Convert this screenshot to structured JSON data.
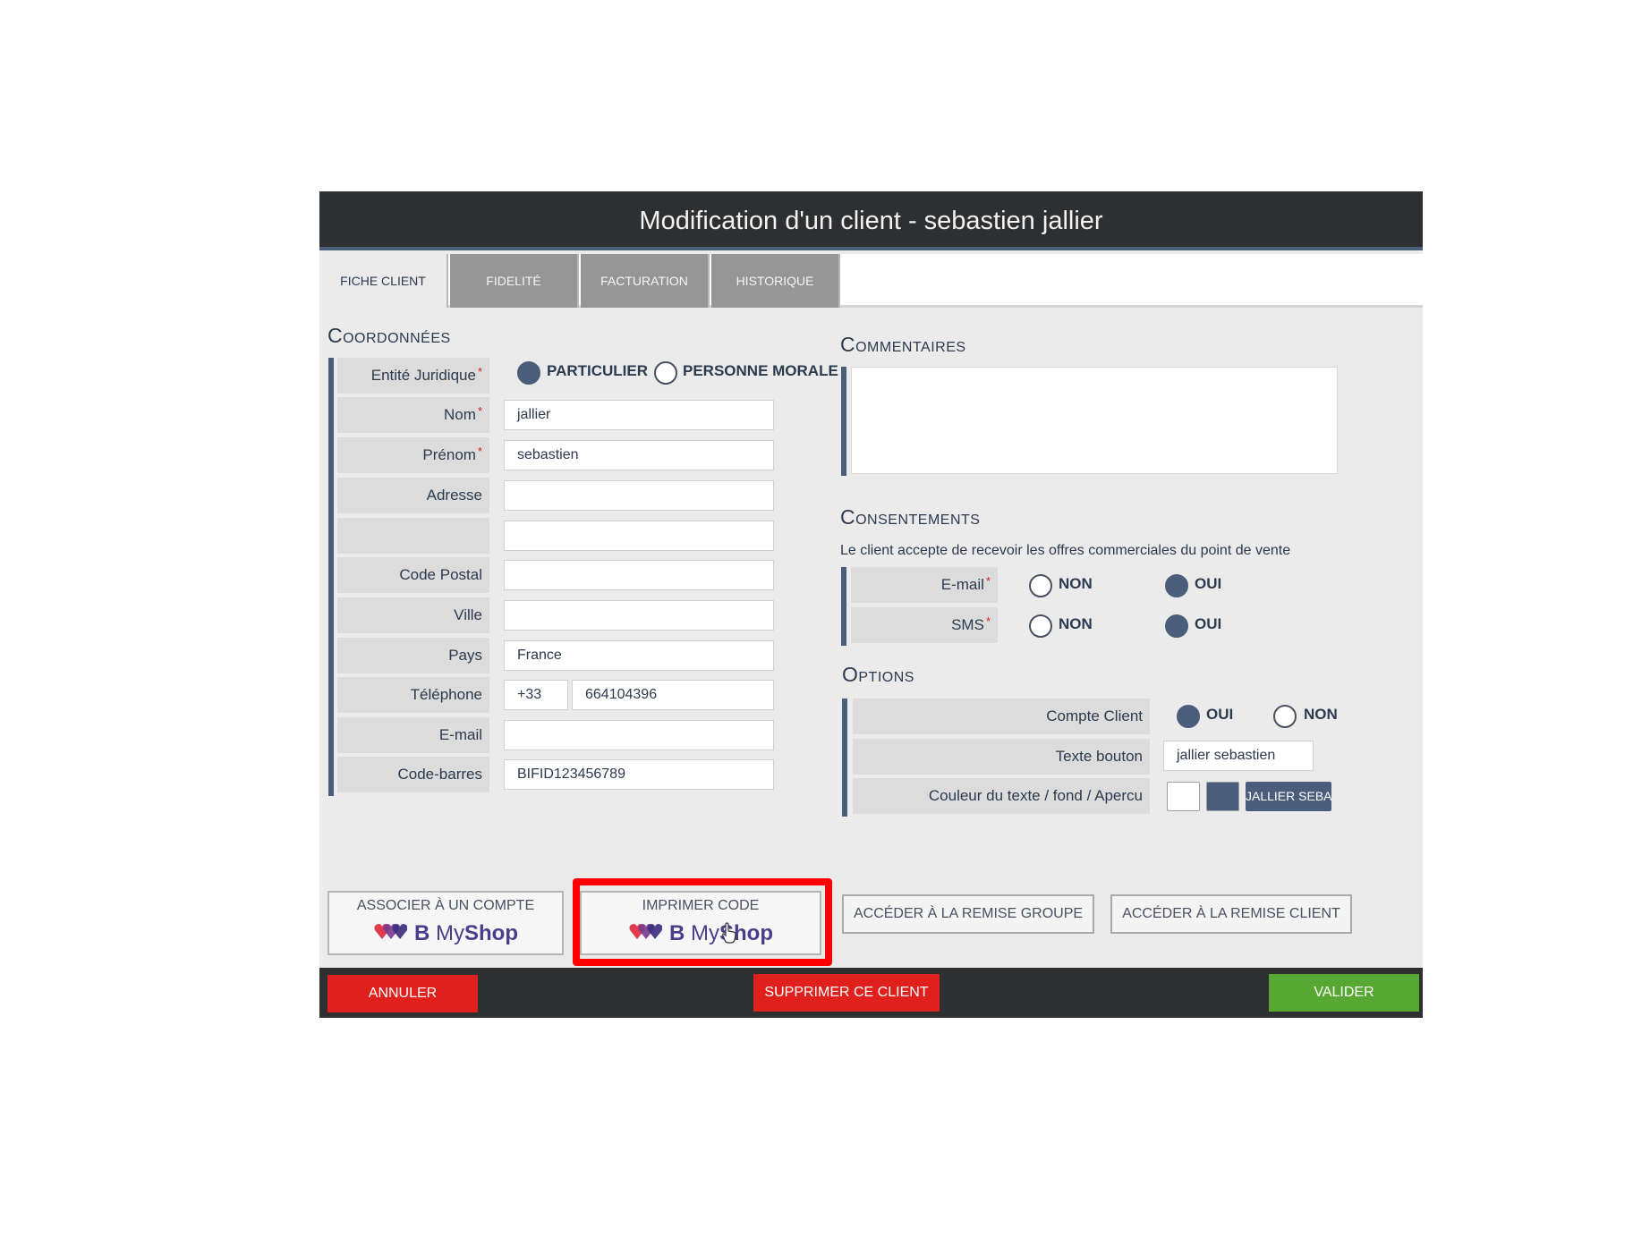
{
  "window": {
    "title": "Modification d'un client - sebastien jallier"
  },
  "tabs": [
    {
      "label": "FICHE CLIENT",
      "active": true
    },
    {
      "label": "FIDELITÉ",
      "active": false
    },
    {
      "label": "FACTURATION",
      "active": false
    },
    {
      "label": "HISTORIQUE",
      "active": false
    }
  ],
  "coordonnees": {
    "title": "Coordonnées",
    "entite": {
      "label": "Entité Juridique",
      "options": [
        {
          "label": "PARTICULIER",
          "selected": true
        },
        {
          "label": "PERSONNE MORALE",
          "selected": false
        }
      ]
    },
    "fields": {
      "nom": {
        "label": "Nom",
        "value": "jallier"
      },
      "prenom": {
        "label": "Prénom",
        "value": "sebastien"
      },
      "adresse": {
        "label": "Adresse",
        "value": ""
      },
      "adresse2": {
        "label": "",
        "value": ""
      },
      "code_postal": {
        "label": "Code Postal",
        "value": ""
      },
      "ville": {
        "label": "Ville",
        "value": ""
      },
      "pays": {
        "label": "Pays",
        "value": "France"
      },
      "telephone": {
        "label": "Téléphone",
        "prefix": "+33",
        "value": "664104396"
      },
      "email": {
        "label": "E-mail",
        "value": ""
      },
      "code_barres": {
        "label": "Code-barres",
        "value": "BIFID123456789"
      }
    },
    "required_mark": "*"
  },
  "commentaires": {
    "title": "Commentaires",
    "value": ""
  },
  "consentements": {
    "title": "Consentements",
    "text": "Le client accepte de recevoir les offres commerciales du point de vente",
    "email": {
      "label": "E-mail",
      "non": "NON",
      "oui": "OUI",
      "selected": "OUI"
    },
    "sms": {
      "label": "SMS",
      "non": "NON",
      "oui": "OUI",
      "selected": "OUI"
    }
  },
  "options": {
    "title": "Options",
    "compte_client": {
      "label": "Compte Client",
      "oui": "OUI",
      "non": "NON",
      "selected": "OUI"
    },
    "texte_bouton": {
      "label": "Texte bouton",
      "value": "jallier sebastien"
    },
    "couleur": {
      "label": "Couleur du texte / fond / Apercu",
      "text_color": "#ffffff",
      "bg_color": "#4a5d7a",
      "preview": "JALLIER SEBASTIEN"
    }
  },
  "actions": {
    "associer": {
      "top": "ASSOCIER À UN COMPTE",
      "brand_b": "B",
      "brand_my": "My",
      "brand_shop": "Shop"
    },
    "imprimer": {
      "top": "IMPRIMER CODE",
      "brand_b": "B",
      "brand_my": "My",
      "brand_shop": "Shop"
    },
    "remise_groupe": "ACCÉDER À LA REMISE GROUPE",
    "remise_client": "ACCÉDER À LA REMISE CLIENT"
  },
  "footer": {
    "annuler": "ANNULER",
    "supprimer": "SUPPRIMER CE CLIENT",
    "valider": "VALIDER"
  },
  "colors": {
    "accent": "#4a5d7a",
    "title_bar": "#2e2f31",
    "danger": "#e0201d",
    "success": "#57a832",
    "highlight": "#ff0000"
  }
}
